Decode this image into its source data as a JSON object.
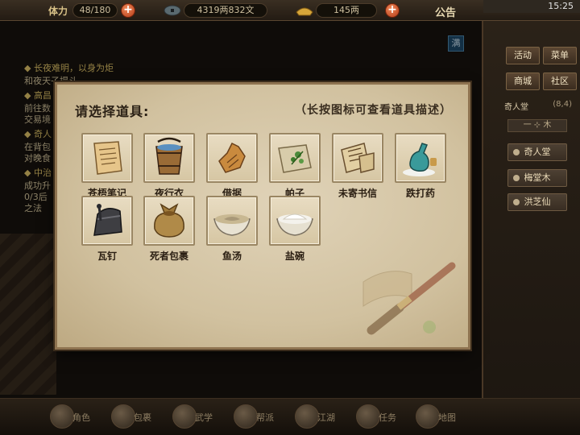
{
  "topbar": {
    "stamina_label": "体力",
    "stamina_value": "48/180",
    "money_value": "4319两832文",
    "gold_value": "145两",
    "notice_label": "公告",
    "time": "15:25"
  },
  "right_panel": {
    "buttons": [
      "活动",
      "菜单",
      "商城",
      "社区"
    ],
    "location_name": "奇人堂",
    "location_coord": "(8,4)",
    "sub_label": "一 ⊹ 木",
    "npcs": [
      "奇人堂",
      "梅堂木",
      "洪芝仙"
    ]
  },
  "quest_panel": {
    "toggle_label": "满",
    "lines": [
      "◆ 长夜难明，以身为炬",
      "和夜天子提斗",
      "◆ 高昌",
      "前往数",
      "交易境",
      "◆ 奇人",
      "在背包",
      "对晚食",
      "◆ 中治",
      "成功升",
      "0/3后",
      "之法"
    ]
  },
  "bottom_toolbar": {
    "labels": [
      "角色",
      "包裹",
      "武学",
      "帮派",
      "江湖",
      "任务",
      "地图"
    ]
  },
  "dialog": {
    "title": "请选择道具:",
    "hint": "（长按图标可查看道具描述）",
    "items": [
      {
        "name": "苍梧笔记",
        "icon": "scroll-notes-icon"
      },
      {
        "name": "夜行衣",
        "icon": "bucket-icon"
      },
      {
        "name": "借据",
        "icon": "torn-paper-icon"
      },
      {
        "name": "帕子",
        "icon": "handkerchief-icon"
      },
      {
        "name": "未寄书信",
        "icon": "letter-icon"
      },
      {
        "name": "跌打药",
        "icon": "medicine-bottle-icon"
      },
      {
        "name": "瓦钉",
        "icon": "tile-nail-icon"
      },
      {
        "name": "死者包裹",
        "icon": "cloth-bundle-icon"
      },
      {
        "name": "鱼汤",
        "icon": "fish-soup-icon"
      },
      {
        "name": "盐碗",
        "icon": "salt-bowl-icon"
      }
    ]
  },
  "colors": {
    "parchment": "#d6c6a3",
    "frame": "#8e7350",
    "accent_red": "#b33a16",
    "text_dark": "#2a2015"
  }
}
